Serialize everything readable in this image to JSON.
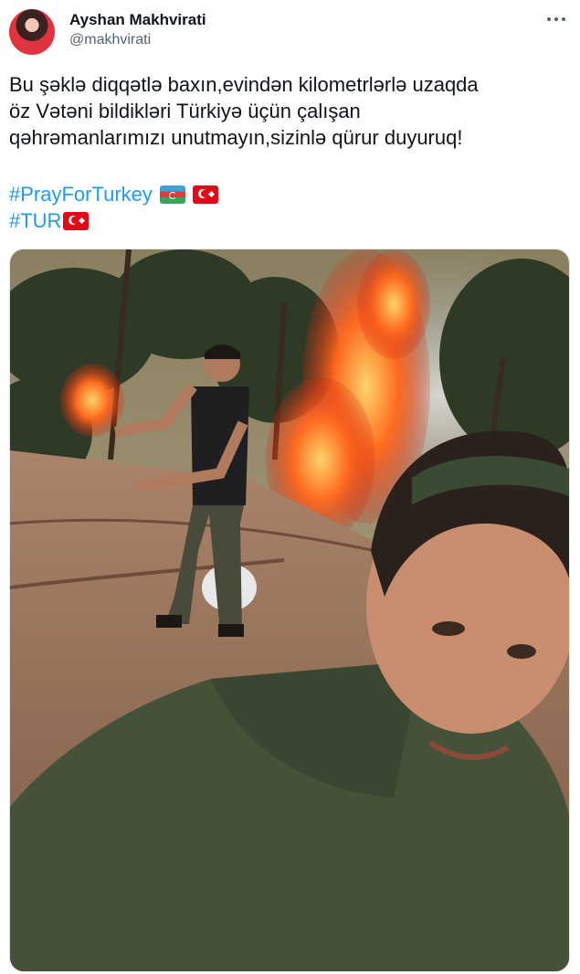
{
  "author": {
    "display_name": "Ayshan Makhvirati",
    "handle": "@makhvirati"
  },
  "tweet": {
    "text_lines": [
      "Bu şəklə diqqətlə baxın,evindən kilometrlərlə uzaqda",
      "öz Vətəni bildikləri Türkiyə üçün çalışan",
      "qəhrəmanlarımızı unutmayın,sizinlə qürur duyuruq!"
    ],
    "hashtags": [
      "#PrayForTurkey",
      "#TUR"
    ],
    "flags": [
      "azerbaijan-flag-emoji",
      "turkey-flag-emoji"
    ]
  },
  "colors": {
    "link": "#1d9bf0",
    "text": "#0f1419",
    "secondary": "#536471"
  }
}
